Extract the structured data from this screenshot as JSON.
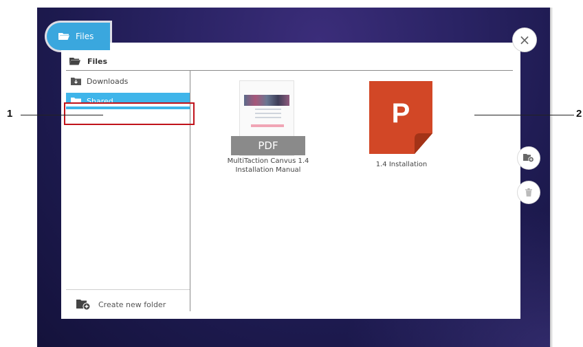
{
  "header": {
    "tab_label": "Files",
    "breadcrumb": "Files"
  },
  "sidebar": {
    "items": [
      {
        "label": "Downloads",
        "icon": "downloads-folder-icon"
      },
      {
        "label": "Shared",
        "icon": "folder-icon",
        "selected": true
      }
    ],
    "create_folder_label": "Create new folder"
  },
  "files": [
    {
      "type_badge": "PDF",
      "name_line1": "MultiTaction Canvus 1.4",
      "name_line2": "Installation Manual",
      "icon": "pdf-thumbnail"
    },
    {
      "name_line1": "1.4 Installation",
      "icon": "powerpoint-icon"
    }
  ],
  "callouts": [
    "1",
    "2"
  ],
  "buttons": {
    "close": "×"
  },
  "colors": {
    "accent": "#3aa7de",
    "selected": "#3fb5ea",
    "ppt": "#d24726",
    "callout_box": "#c0121a"
  }
}
